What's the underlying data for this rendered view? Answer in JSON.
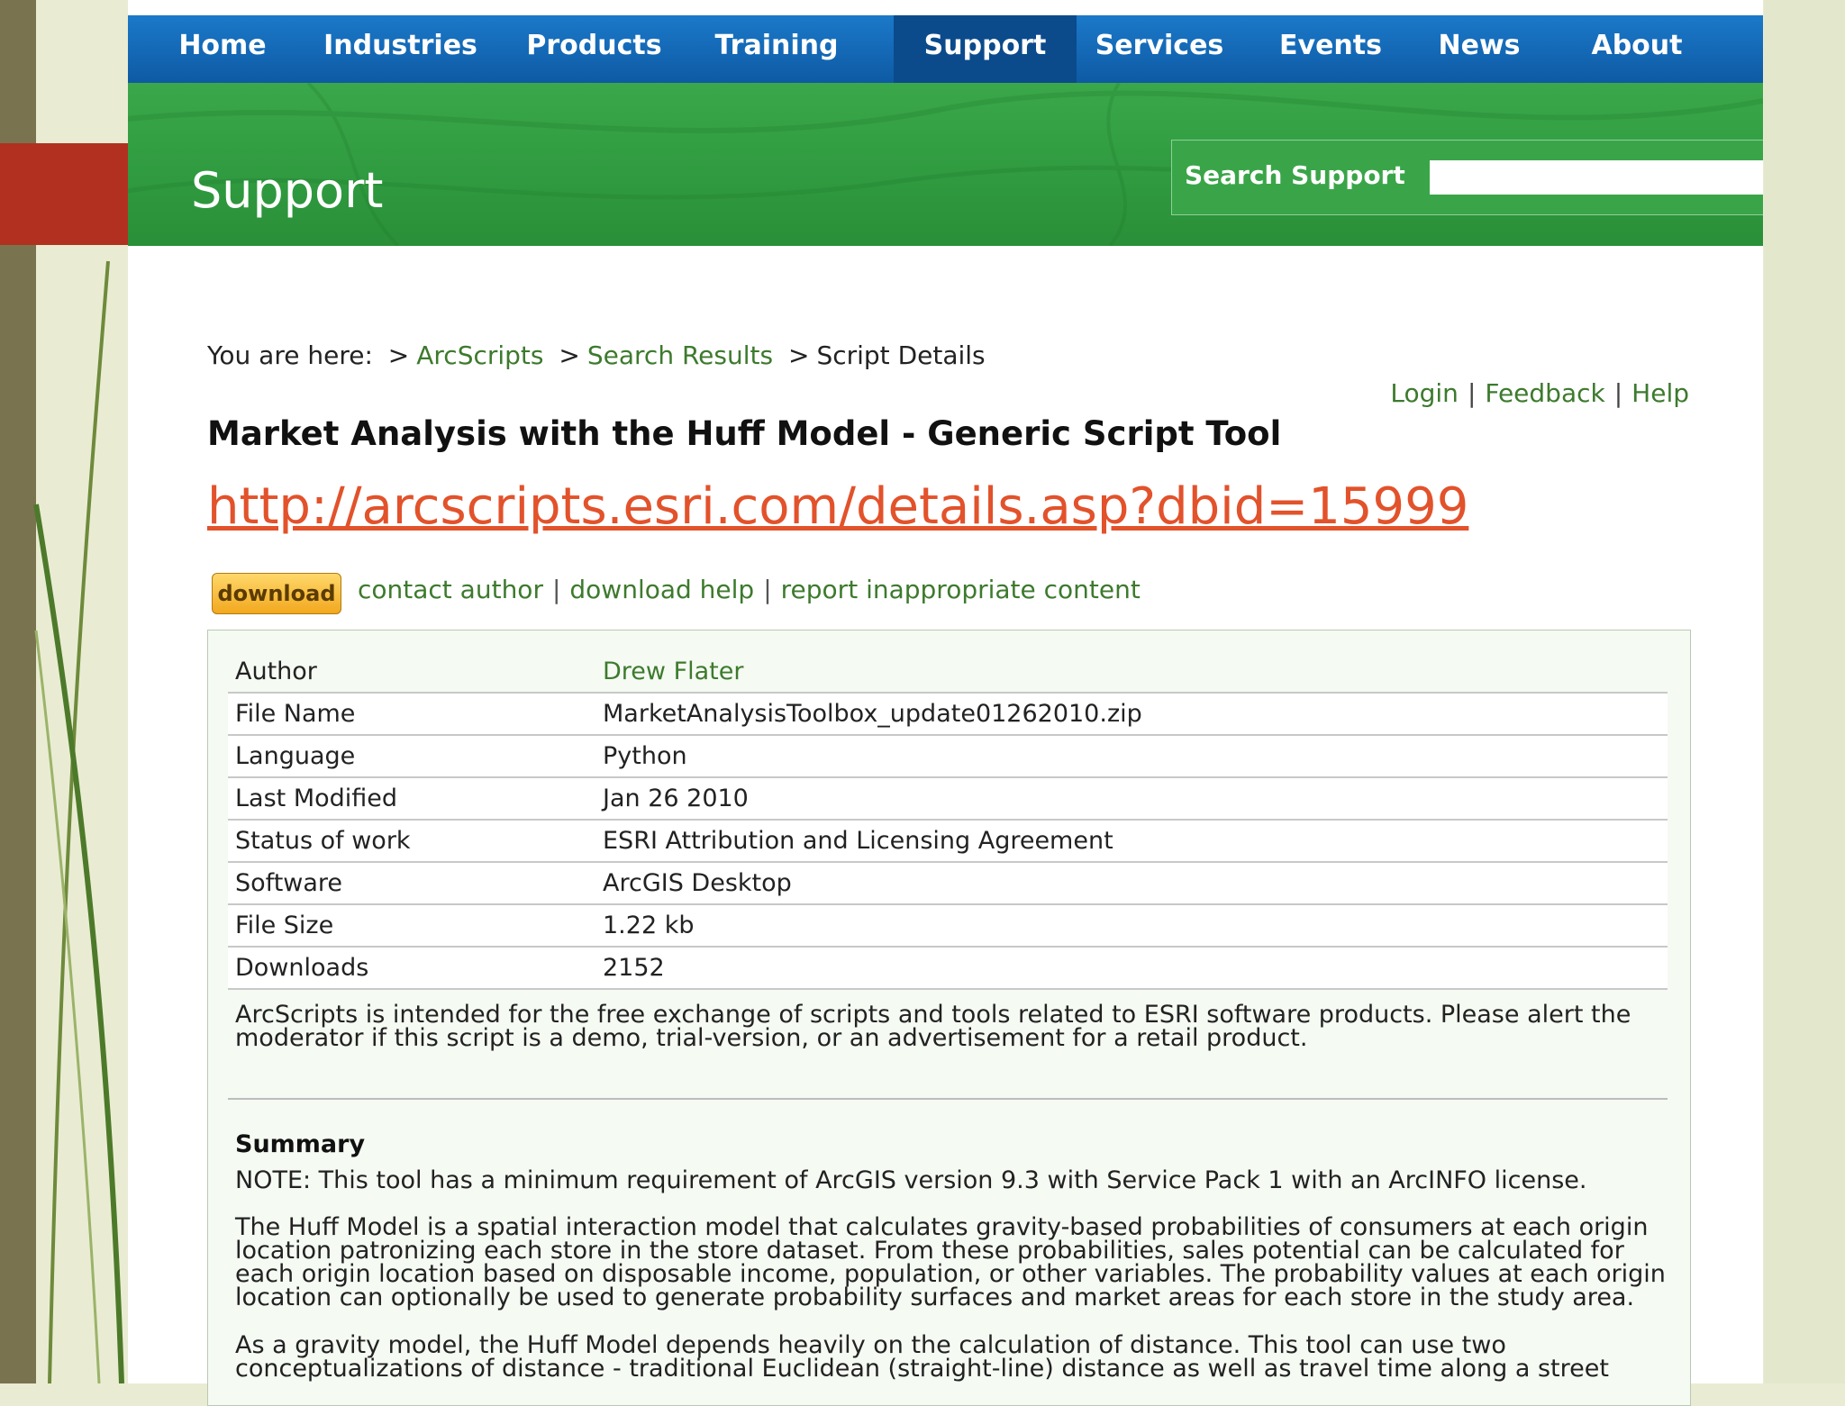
{
  "nav": {
    "items": [
      "Home",
      "Industries",
      "Products",
      "Training",
      "Support",
      "Services",
      "Events",
      "News",
      "About"
    ],
    "active": "Support"
  },
  "banner": {
    "title": "Support",
    "search_label": "Search Support",
    "search_value": ""
  },
  "breadcrumb": {
    "prefix": "You are here:",
    "sep": ">",
    "items": [
      "ArcScripts",
      "Search Results",
      "Script Details"
    ]
  },
  "toplinks": {
    "login": "Login",
    "feedback": "Feedback",
    "help": "Help",
    "sep": "|"
  },
  "page_title": "Market Analysis with the Huff Model - Generic Script Tool",
  "url": "http://arcscripts.esri.com/details.asp?dbid=15999",
  "actions": {
    "download": "download",
    "contact": "contact author",
    "download_help": "download help",
    "report": "report inappropriate content",
    "sep": "|"
  },
  "details": [
    {
      "key": "Author",
      "value": "Drew Flater"
    },
    {
      "key": "File Name",
      "value": "MarketAnalysisToolbox_update01262010.zip"
    },
    {
      "key": "Language",
      "value": "Python"
    },
    {
      "key": "Last Modified",
      "value": "Jan 26 2010"
    },
    {
      "key": "Status of work",
      "value": "ESRI Attribution and Licensing Agreement"
    },
    {
      "key": "Software",
      "value": "ArcGIS Desktop"
    },
    {
      "key": "File Size",
      "value": "1.22 kb"
    },
    {
      "key": "Downloads",
      "value": "2152"
    }
  ],
  "notice": "ArcScripts is intended for the free exchange of scripts and tools related to ESRI software products. Please alert the moderator if this script is a demo, trial-version, or an advertisement for a retail product.",
  "summary": {
    "heading": "Summary",
    "p1": "NOTE: This tool has a minimum requirement of ArcGIS version 9.3 with Service Pack 1 with an ArcINFO license.",
    "p2": "The Huff Model is a spatial interaction model that calculates gravity-based probabilities of consumers at each origin location patronizing each store in the store dataset. From these probabilities, sales potential can be calculated for each origin location based on disposable income, population, or other variables. The probability values at each origin location can optionally be used to generate probability surfaces and market areas for each store in the study area.",
    "p3": "As a gravity model, the Huff Model depends heavily on the calculation of distance. This tool can use two conceptualizations of distance - traditional Euclidean (straight-line) distance as well as travel time along a street"
  },
  "colors": {
    "nav_blue": "#1668b8",
    "banner_green": "#35a146",
    "link_green": "#3d7a2d",
    "url_orange": "#e2522b",
    "deco_red": "#b2301f"
  }
}
